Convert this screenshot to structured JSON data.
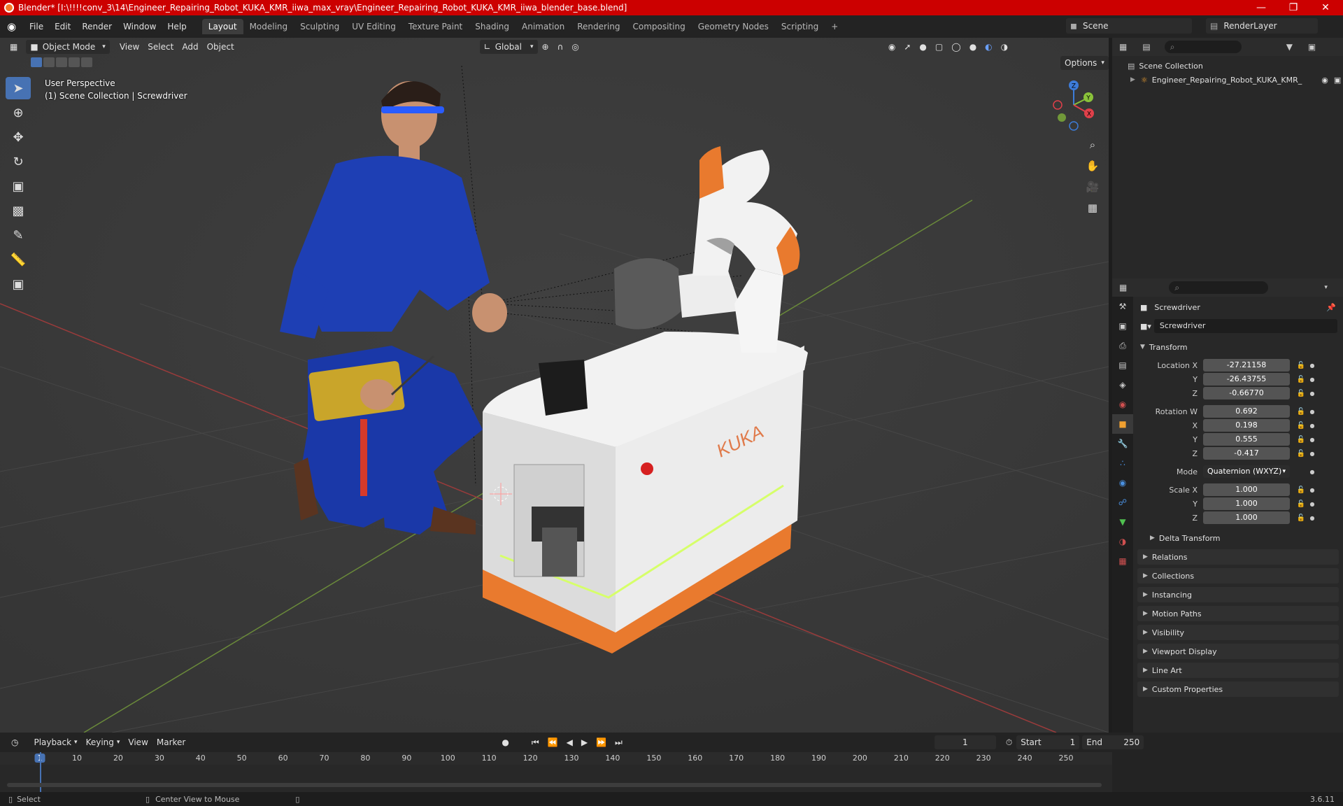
{
  "titlebar": {
    "title": "Blender* [I:\\!!!!conv_3\\14\\Engineer_Repairing_Robot_KUKA_KMR_iiwa_max_vray\\Engineer_Repairing_Robot_KUKA_KMR_iiwa_blender_base.blend]",
    "color": "#cc0000"
  },
  "menu": {
    "items": [
      "File",
      "Edit",
      "Render",
      "Window",
      "Help"
    ]
  },
  "workspaces": {
    "tabs": [
      "Layout",
      "Modeling",
      "Sculpting",
      "UV Editing",
      "Texture Paint",
      "Shading",
      "Animation",
      "Rendering",
      "Compositing",
      "Geometry Nodes",
      "Scripting"
    ],
    "active": "Layout",
    "add": "+"
  },
  "scene": {
    "label": "Scene"
  },
  "viewlayer": {
    "label": "RenderLayer"
  },
  "viewport_header": {
    "mode": "Object Mode",
    "menus": [
      "View",
      "Select",
      "Add",
      "Object"
    ],
    "orientation": "Global",
    "options": "Options"
  },
  "viewport_info": {
    "line1": "User Perspective",
    "line2": "(1) Scene Collection | Screwdriver"
  },
  "scene_text": {
    "kuka": "KUKA"
  },
  "gizmo": {
    "x": "X",
    "y": "Y",
    "z": "Z"
  },
  "outliner": {
    "root": "Scene Collection",
    "item": "Engineer_Repairing_Robot_KUKA_KMR_"
  },
  "properties": {
    "object_name": "Screwdriver",
    "data_name": "Screwdriver",
    "transform_label": "Transform",
    "location_label": "Location X",
    "location": {
      "x": "-27.21158",
      "y": "-26.43755",
      "z": "-0.66770"
    },
    "rotation_label": "Rotation W",
    "rotation": {
      "w": "0.692",
      "x": "0.198",
      "y": "0.555",
      "z": "-0.417"
    },
    "mode_label": "Mode",
    "mode_value": "Quaternion (WXYZ)",
    "scale_label": "Scale X",
    "scale": {
      "x": "1.000",
      "y": "1.000",
      "z": "1.000"
    },
    "axis_y": "Y",
    "axis_z": "Z",
    "axis_x": "X",
    "delta": "Delta Transform",
    "panels": [
      "Relations",
      "Collections",
      "Instancing",
      "Motion Paths",
      "Visibility",
      "Viewport Display",
      "Line Art",
      "Custom Properties"
    ]
  },
  "timeline": {
    "menus": [
      "Playback",
      "Keying",
      "View",
      "Marker"
    ],
    "current_frame": "1",
    "start_label": "Start",
    "start": "1",
    "end_label": "End",
    "end": "250",
    "ticks": [
      "1",
      "10",
      "20",
      "30",
      "40",
      "50",
      "60",
      "70",
      "80",
      "90",
      "100",
      "110",
      "120",
      "130",
      "140",
      "150",
      "160",
      "170",
      "180",
      "190",
      "200",
      "210",
      "220",
      "230",
      "240",
      "250"
    ]
  },
  "status": {
    "select": "Select",
    "center": "Center View to Mouse",
    "version": "3.6.11"
  }
}
